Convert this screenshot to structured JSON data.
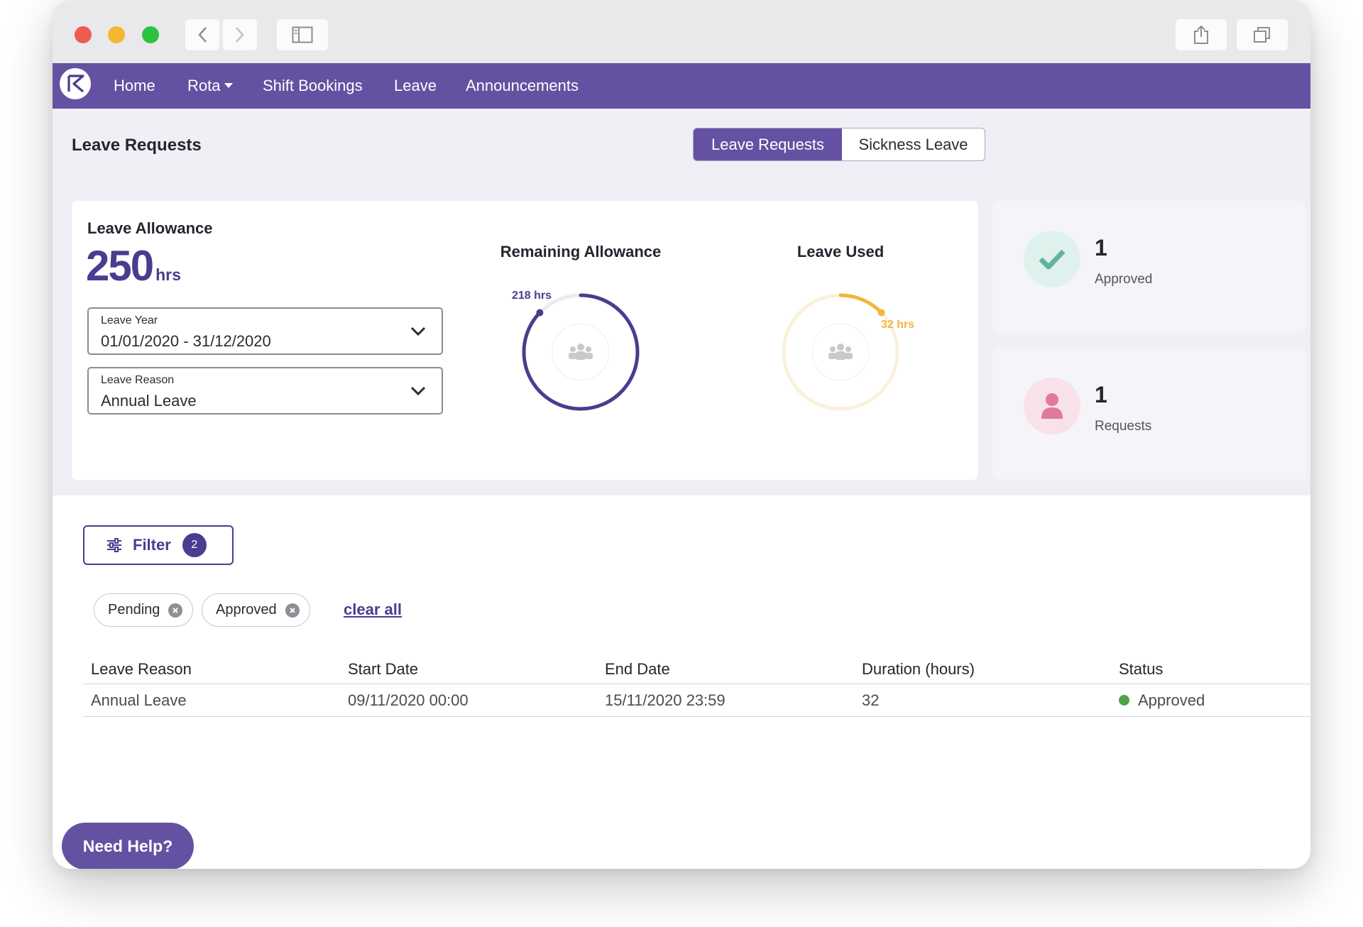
{
  "nav": {
    "items": [
      {
        "label": "Home"
      },
      {
        "label": "Rota"
      },
      {
        "label": "Shift Bookings"
      },
      {
        "label": "Leave"
      },
      {
        "label": "Announcements"
      }
    ]
  },
  "header": {
    "title": "Leave Requests",
    "tabs": [
      {
        "label": "Leave Requests",
        "active": true
      },
      {
        "label": "Sickness Leave",
        "active": false
      }
    ]
  },
  "allowance": {
    "label": "Leave Allowance",
    "value": "250",
    "unit": "hrs",
    "leave_year": {
      "label": "Leave Year",
      "value": "01/01/2020 - 31/12/2020"
    },
    "leave_reason": {
      "label": "Leave Reason",
      "value": "Annual Leave"
    }
  },
  "rings": {
    "remaining": {
      "title": "Remaining Allowance",
      "value_label": "218 hrs",
      "color": "#4a3c8f",
      "fraction": 0.872
    },
    "used": {
      "title": "Leave Used",
      "value_label": "32 hrs",
      "color": "#f2b53c",
      "fraction": 0.128
    }
  },
  "stats": {
    "approved": {
      "count": "1",
      "label": "Approved",
      "color": "#5fb3a3"
    },
    "requests": {
      "count": "1",
      "label": "Requests",
      "color": "#e07a9b"
    }
  },
  "filter": {
    "label": "Filter",
    "badge": "2",
    "chips": [
      {
        "label": "Pending"
      },
      {
        "label": "Approved"
      }
    ],
    "clear_all": "clear all"
  },
  "table": {
    "headers": [
      "Leave Reason",
      "Start Date",
      "End Date",
      "Duration (hours)",
      "Status"
    ],
    "rows": [
      [
        "Annual Leave",
        "09/11/2020 00:00",
        "15/11/2020 23:59",
        "32",
        "Approved"
      ]
    ]
  },
  "help": {
    "label": "Need Help?"
  },
  "colors": {
    "brand": "#6451a1",
    "accent": "#4a3c8f",
    "approved_dot": "#4fa345"
  }
}
